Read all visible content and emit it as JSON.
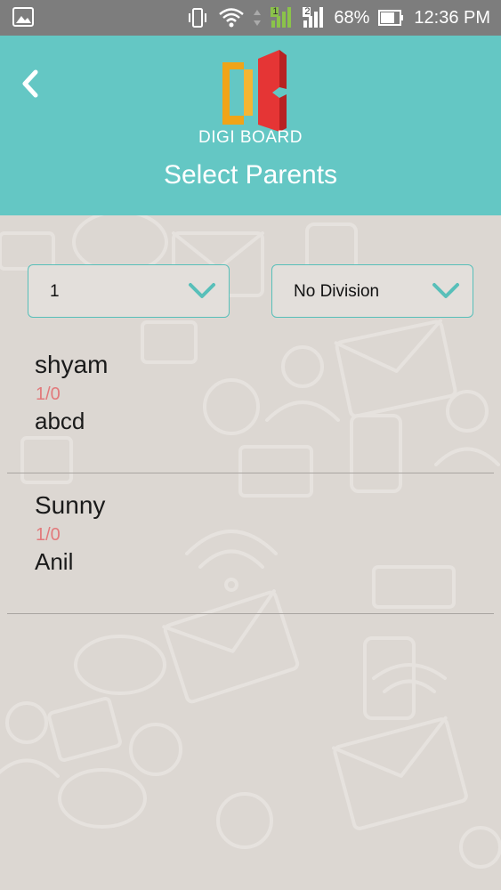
{
  "status_bar": {
    "battery": "68%",
    "time": "12:36 PM",
    "sim1_label": "1",
    "sim2_label": "2"
  },
  "header": {
    "brand": "DIGI BOARD",
    "title": "Select Parents",
    "background_color": "#64c7c4"
  },
  "filters": {
    "class_value": "1",
    "division_value": "No Division"
  },
  "parents": [
    {
      "name": "shyam",
      "count": "1/0",
      "parent_name": "abcd"
    },
    {
      "name": "Sunny",
      "count": "1/0",
      "parent_name": "Anil"
    }
  ],
  "icons": {
    "back": "back-arrow-icon",
    "chevron": "chevron-down-icon"
  }
}
